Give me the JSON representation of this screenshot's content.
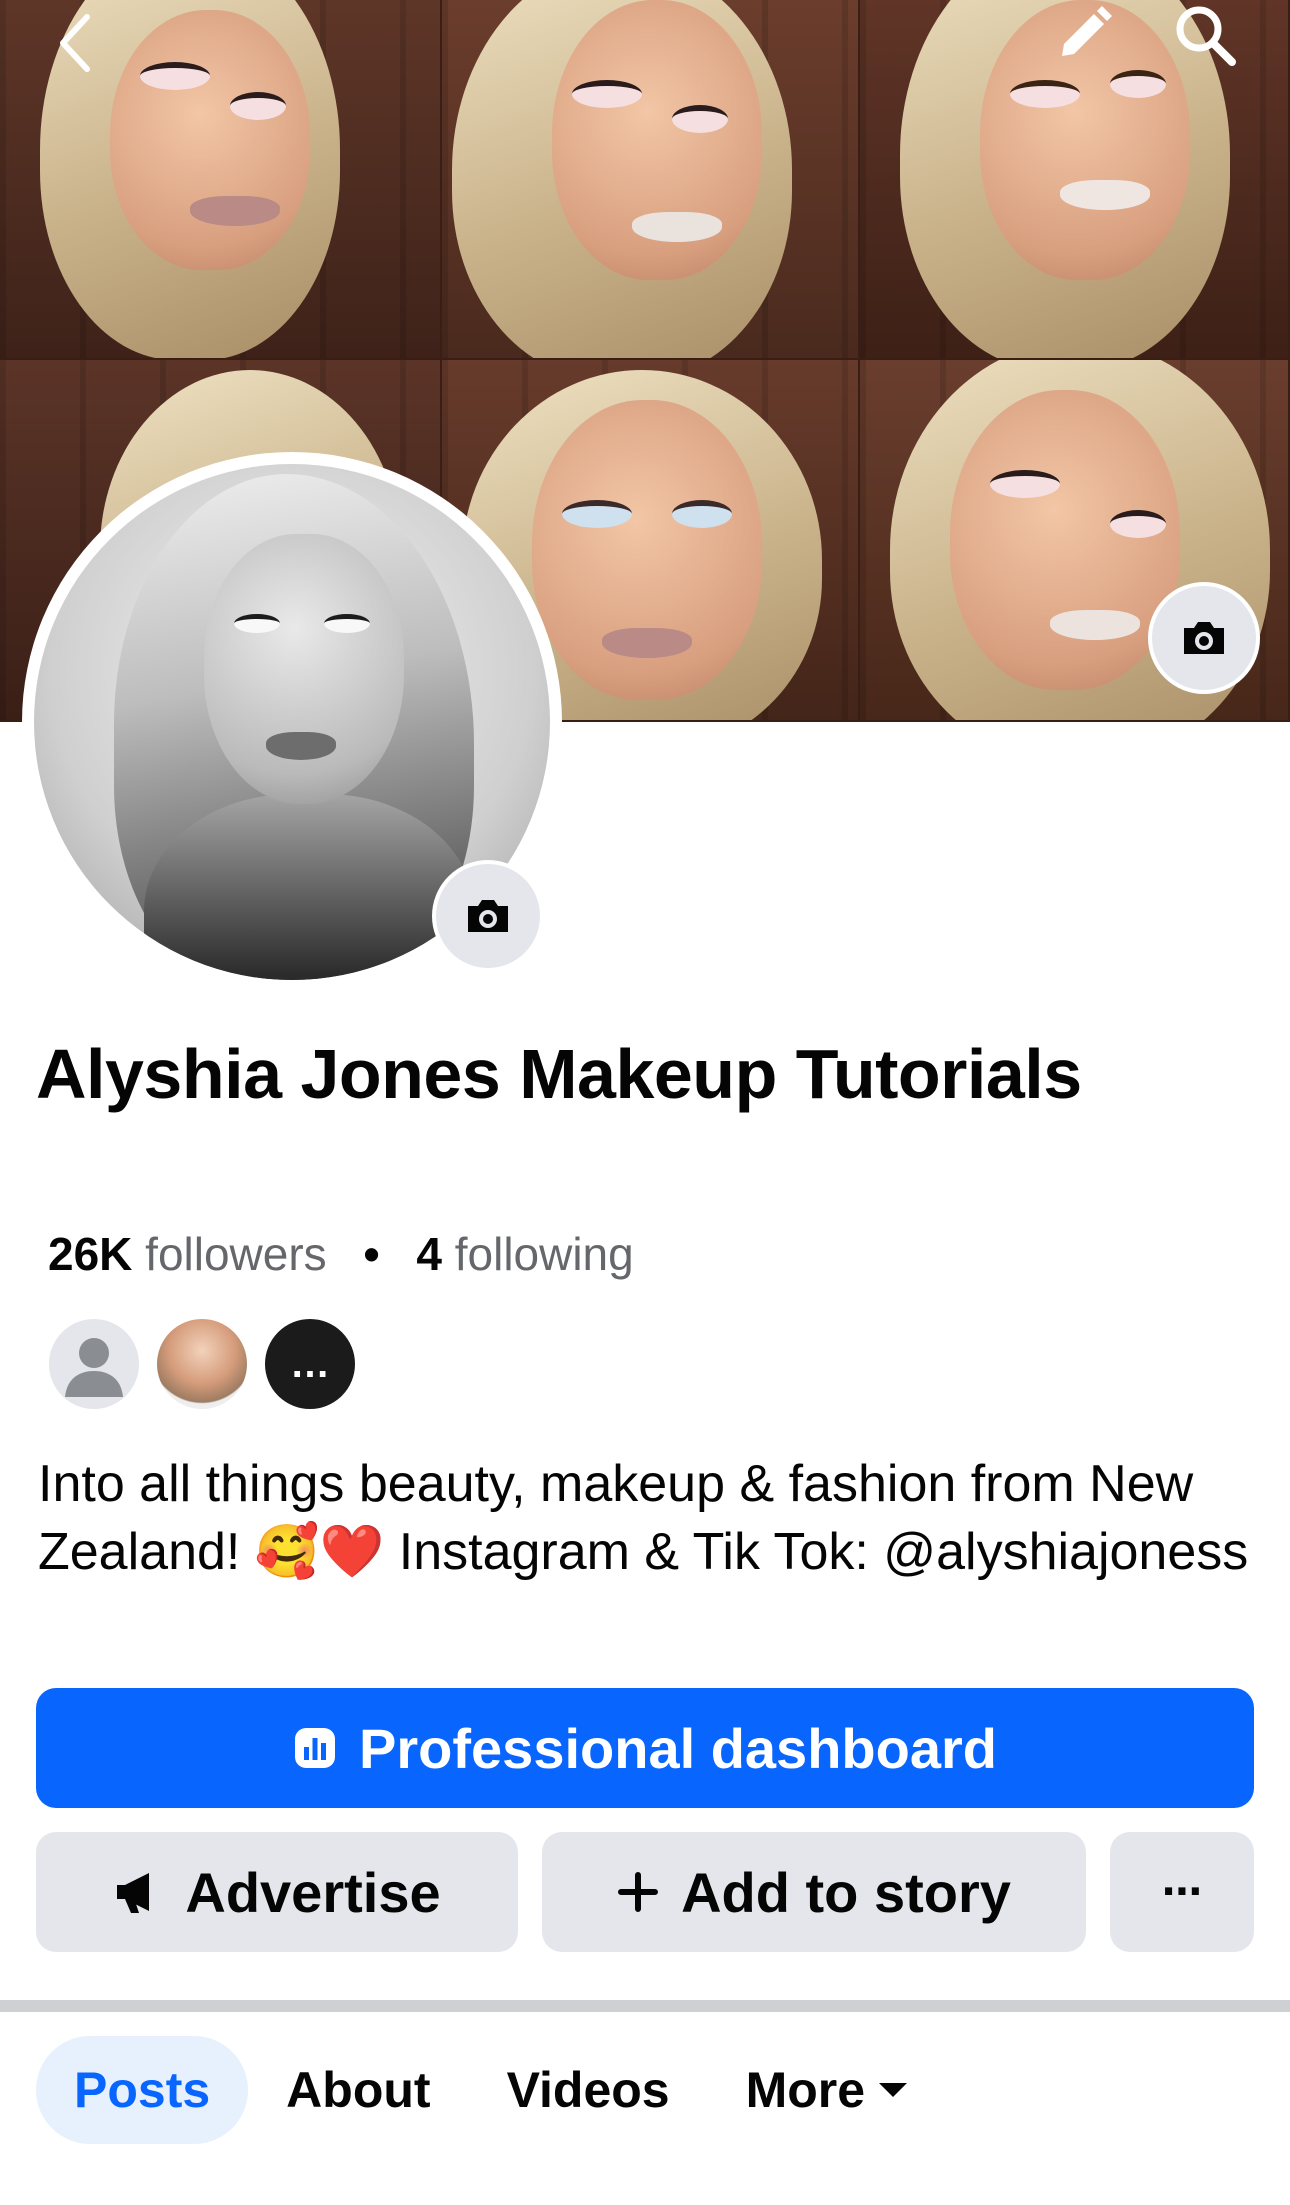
{
  "header": {
    "back_icon": "chevron-left-icon",
    "edit_icon": "pencil-icon",
    "search_icon": "search-icon"
  },
  "cover": {
    "photo_count": 6,
    "camera_icon": "camera-icon"
  },
  "profile": {
    "name": "Alyshia Jones Makeup Tutorials",
    "followers_count": "26K",
    "followers_label": "followers",
    "separator": "•",
    "following_count": "4",
    "following_label": "following",
    "mutual_more": "…",
    "bio": "Into all things beauty, makeup & fashion from New Zealand! 🥰❤️ Instagram & Tik Tok: @alyshiajoness"
  },
  "actions": {
    "professional_dashboard": "Professional dashboard",
    "advertise": "Advertise",
    "add_to_story": "Add to story",
    "more": "⋯"
  },
  "tabs": [
    {
      "label": "Posts",
      "active": true
    },
    {
      "label": "About",
      "active": false
    },
    {
      "label": "Videos",
      "active": false
    },
    {
      "label": "More",
      "active": false
    }
  ],
  "colors": {
    "primary": "#0866ff",
    "secondary_button": "#e4e6eb",
    "active_tab_bg": "#e7f0fd"
  }
}
